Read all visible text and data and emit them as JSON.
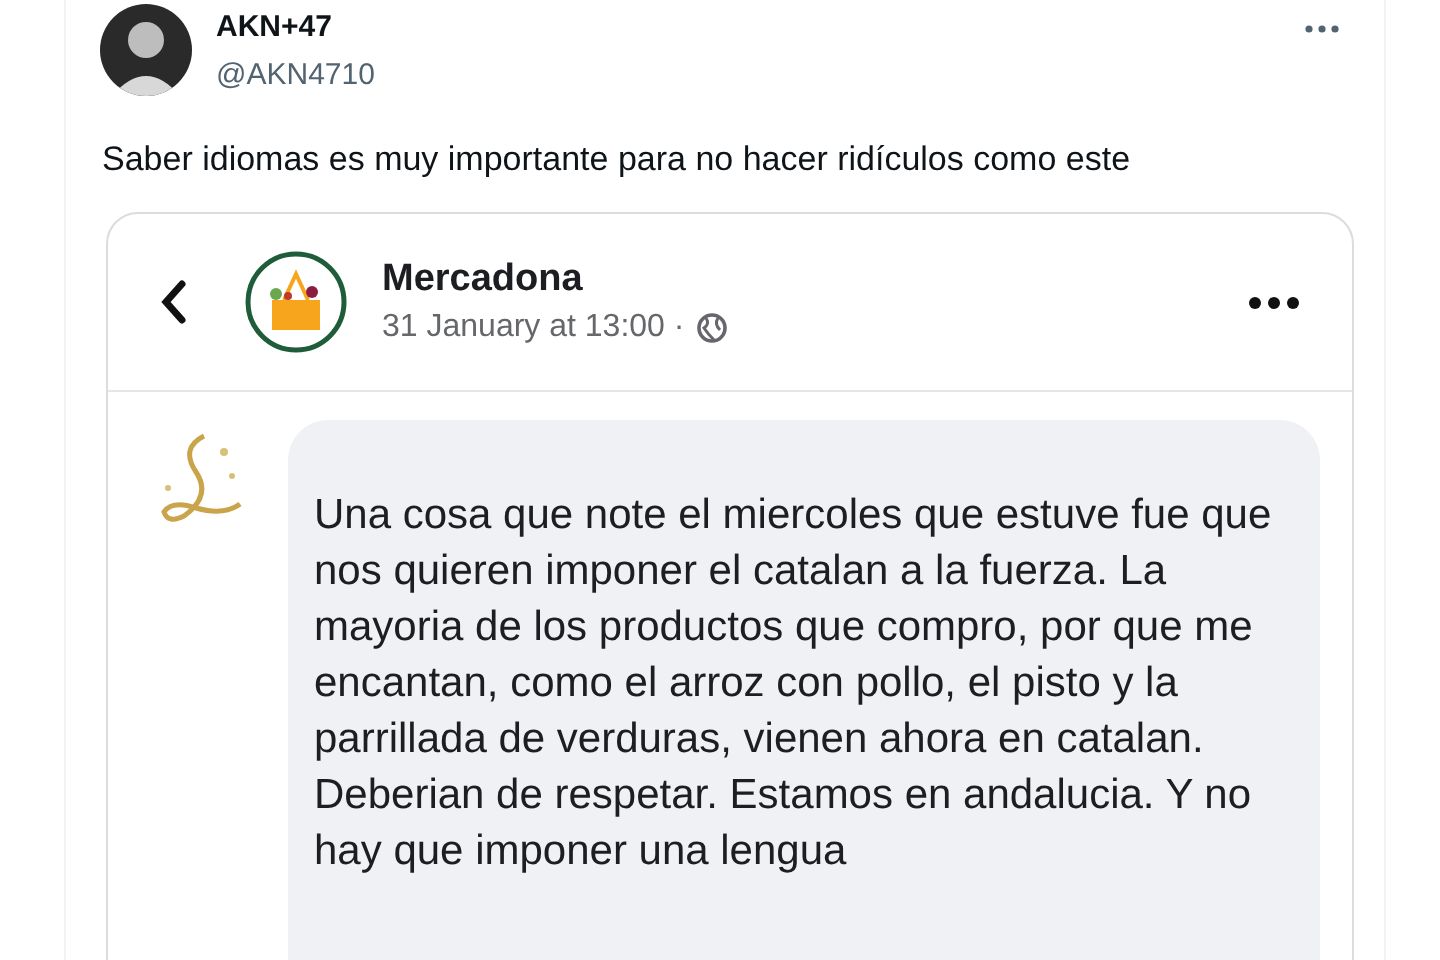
{
  "tweet": {
    "display_name": "AKN+47",
    "handle": "@AKN4710",
    "text": "Saber idiomas es muy importante para no hacer ridículos como este"
  },
  "embedded_post": {
    "page_name": "Mercadona",
    "timestamp": "31 January at 13:00 ·",
    "comment": {
      "text": "Una cosa que note el miercoles que estuve fue que nos quieren imponer el catalan a la fuerza. La mayoria de los productos que compro, por que me encantan, como el arroz con pollo, el pisto y la parrillada de verduras, vienen ahora en catalan. Deberian de respetar. Estamos en andalucia. Y no hay que imponer una lengua"
    }
  }
}
